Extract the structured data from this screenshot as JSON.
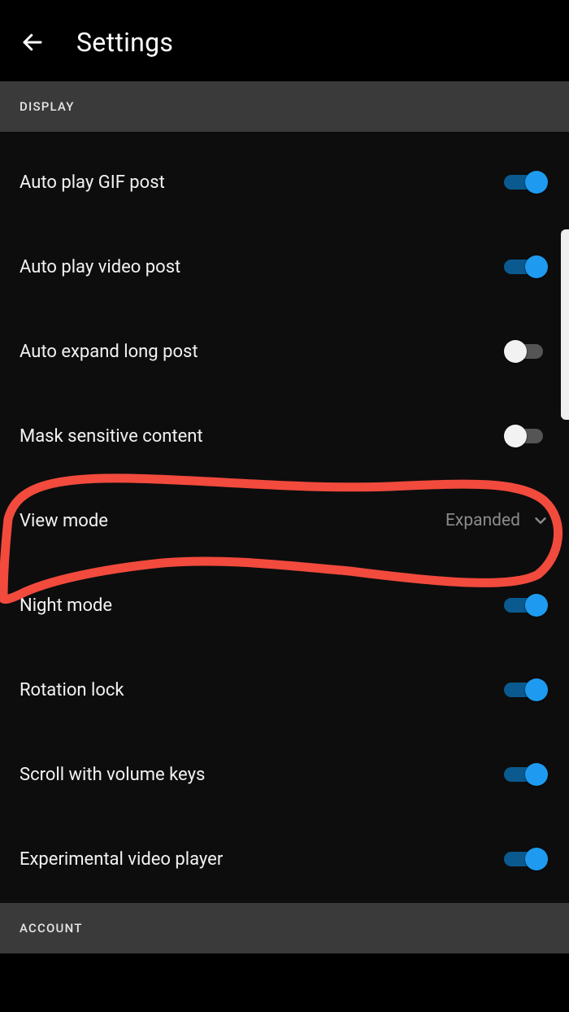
{
  "header": {
    "title": "Settings"
  },
  "sections": {
    "display": {
      "header": "DISPLAY",
      "items": {
        "auto_play_gif": {
          "label": "Auto play GIF post",
          "on": true
        },
        "auto_play_video": {
          "label": "Auto play video post",
          "on": true
        },
        "auto_expand_long": {
          "label": "Auto expand long post",
          "on": false
        },
        "mask_sensitive": {
          "label": "Mask sensitive content",
          "on": false
        },
        "view_mode": {
          "label": "View mode",
          "value": "Expanded"
        },
        "night_mode": {
          "label": "Night mode",
          "on": true
        },
        "rotation_lock": {
          "label": "Rotation lock",
          "on": true
        },
        "scroll_volume": {
          "label": "Scroll with volume keys",
          "on": true
        },
        "experimental_video": {
          "label": "Experimental video player",
          "on": true
        }
      }
    },
    "account": {
      "header": "ACCOUNT"
    }
  }
}
